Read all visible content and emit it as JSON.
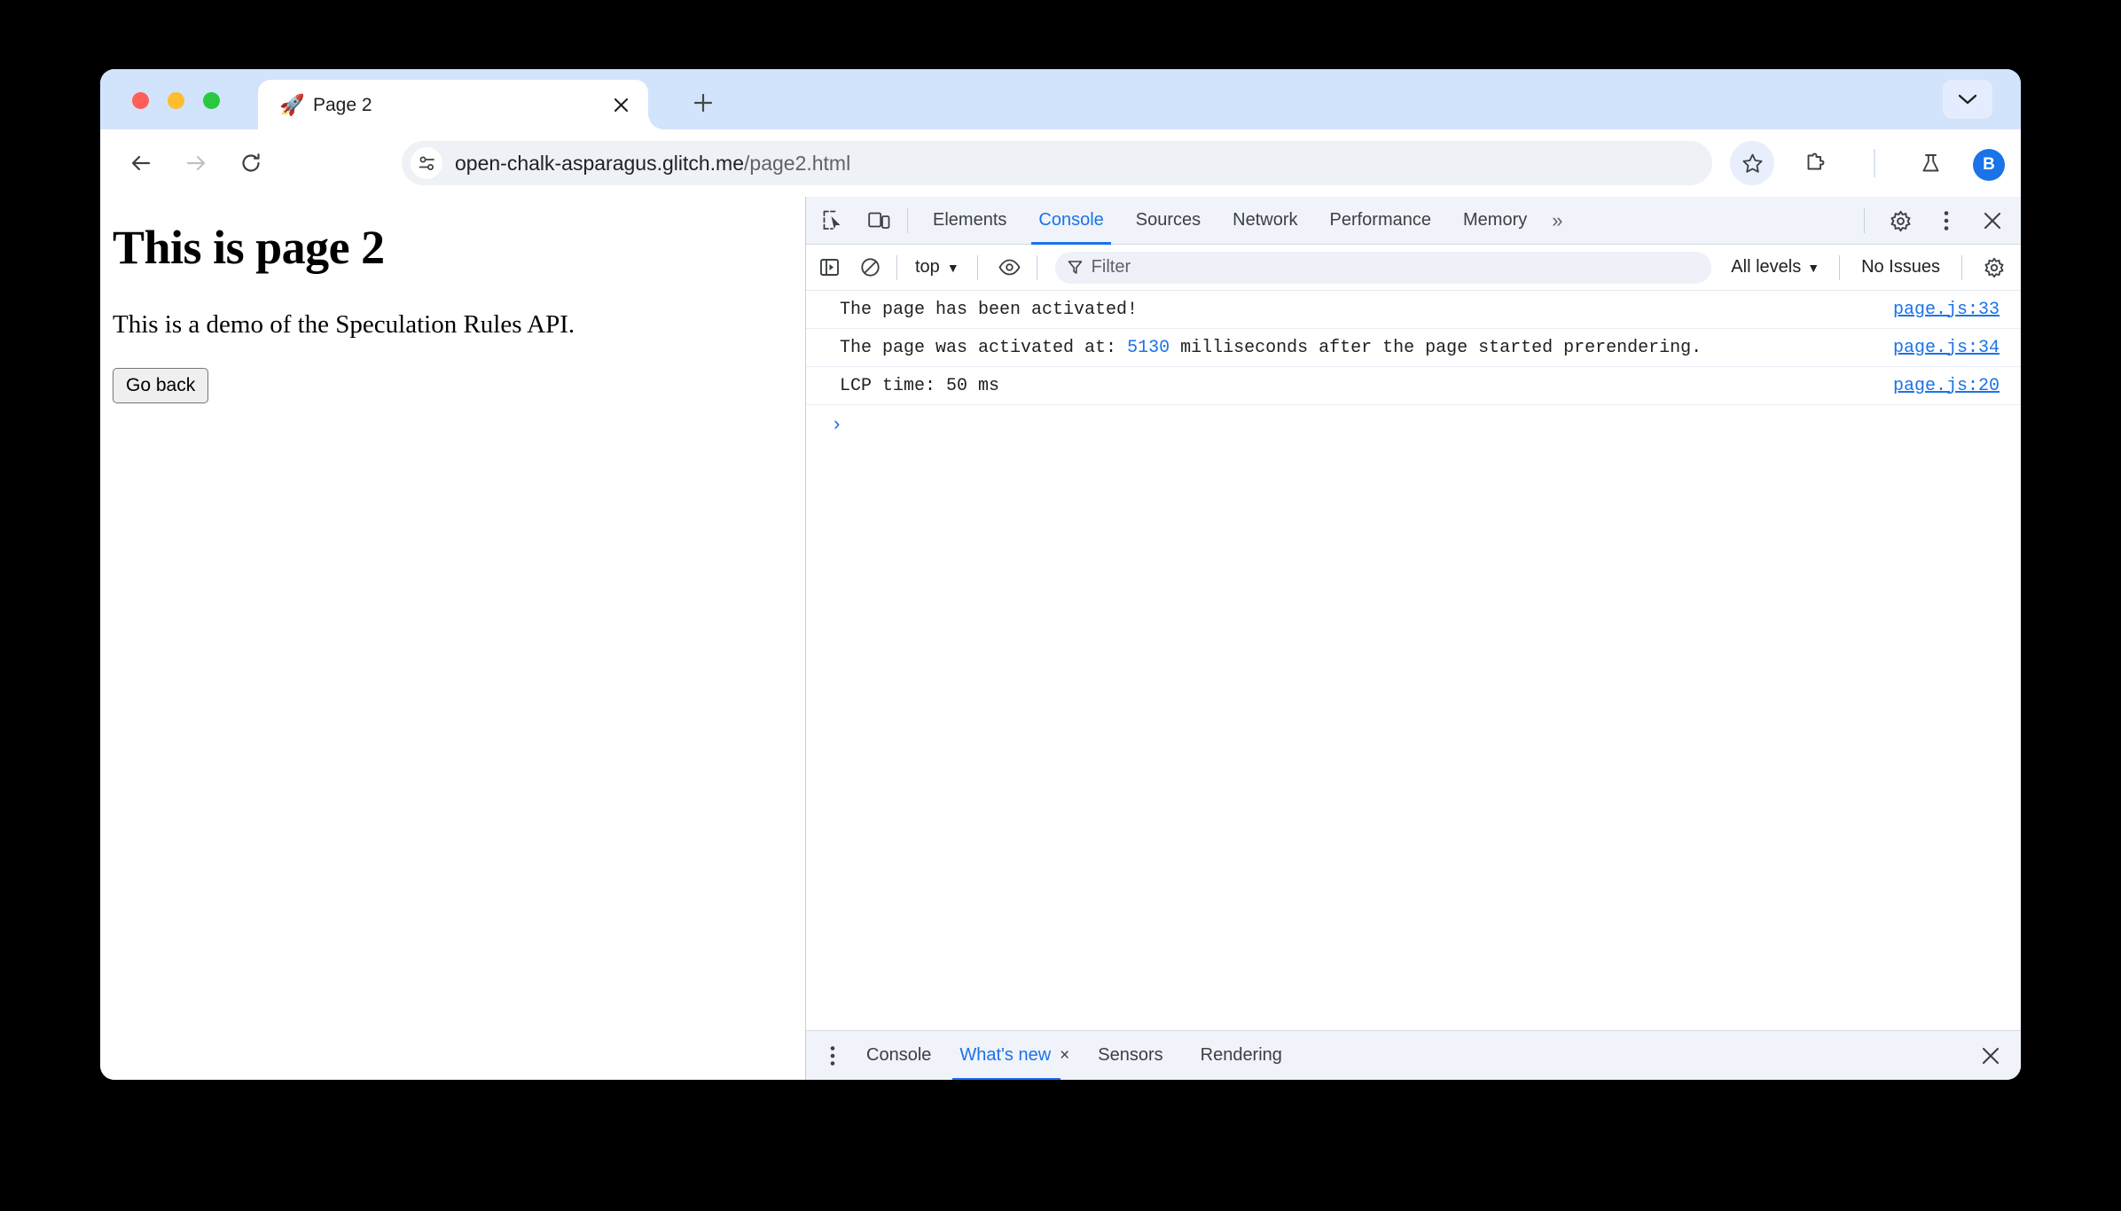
{
  "window": {
    "tab": {
      "favicon": "rocket-icon",
      "title": "Page 2",
      "close_label": "×"
    },
    "new_tab_label": "+",
    "tabstrip_expand_icon": "chevron-down-icon"
  },
  "toolbar": {
    "back_icon": "arrow-left-icon",
    "forward_icon": "arrow-right-icon",
    "reload_icon": "reload-icon",
    "site_info_icon": "site-settings-icon",
    "url_host": "open-chalk-asparagus.glitch.me",
    "url_path": "/page2.html",
    "bookmark_icon": "star-icon",
    "extensions_icon": "puzzle-icon",
    "labs_icon": "flask-icon",
    "avatar_initial": "B",
    "menu_icon": "three-dots-vertical-icon"
  },
  "page": {
    "heading": "This is page 2",
    "paragraph": "This is a demo of the Speculation Rules API.",
    "go_back_label": "Go back"
  },
  "devtools": {
    "inspect_icon": "inspect-element-icon",
    "device_icon": "device-toolbar-icon",
    "tabs": [
      {
        "label": "Elements",
        "active": false
      },
      {
        "label": "Console",
        "active": true
      },
      {
        "label": "Sources",
        "active": false
      },
      {
        "label": "Network",
        "active": false
      },
      {
        "label": "Performance",
        "active": false
      },
      {
        "label": "Memory",
        "active": false
      }
    ],
    "overflow_label": "»",
    "settings_icon": "gear-icon",
    "more_icon": "three-dots-vertical-icon",
    "close_icon": "close-icon",
    "console_toolbar": {
      "sidebar_icon": "console-sidebar-icon",
      "clear_icon": "clear-console-icon",
      "context": "top",
      "context_caret": "▼",
      "live_expression_icon": "eye-icon",
      "filter_icon": "filter-icon",
      "filter_placeholder": "Filter",
      "filter_value": "",
      "levels": "All levels",
      "levels_caret": "▼",
      "issues": "No Issues",
      "settings_icon": "gear-icon"
    },
    "messages": [
      {
        "text_before": "The page has been activated!",
        "number": "",
        "text_after": "",
        "source": "page.js:33"
      },
      {
        "text_before": "The page was activated at: ",
        "number": "5130",
        "text_after": "  milliseconds after the page started prerendering.",
        "source": "page.js:34"
      },
      {
        "text_before": "LCP time: 50 ms",
        "number": "",
        "text_after": "",
        "source": "page.js:20"
      }
    ],
    "prompt_caret": "›",
    "drawer": {
      "more_icon": "three-dots-vertical-icon",
      "tabs": [
        {
          "label": "Console",
          "active": false,
          "closable": false
        },
        {
          "label": "What's new",
          "active": true,
          "closable": true
        },
        {
          "label": "Sensors",
          "active": false,
          "closable": false
        },
        {
          "label": "Rendering",
          "active": false,
          "closable": false
        }
      ],
      "tab_close_label": "×",
      "close_icon": "close-icon"
    }
  },
  "colors": {
    "tabstrip": "#d2e3fc",
    "accent": "#1a73e8",
    "devtools_chrome": "#f0f3fa",
    "traffic_red": "#ff5f57",
    "traffic_yellow": "#febc2e",
    "traffic_green": "#28c840"
  }
}
